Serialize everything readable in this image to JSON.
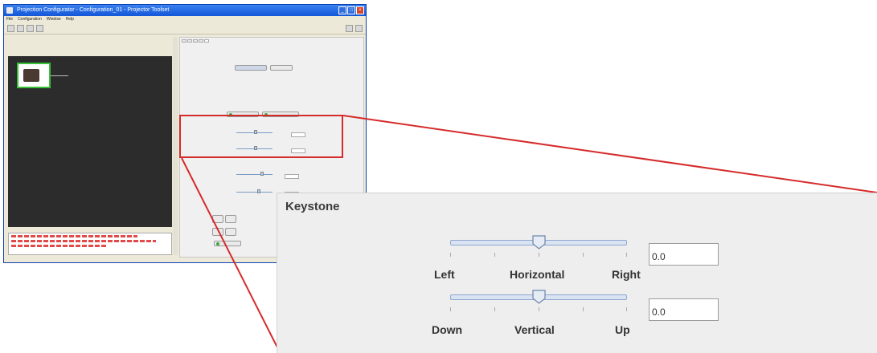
{
  "window": {
    "title": "Projection Configurator - Configuration_01 - Projector Toolset",
    "menu": [
      "File",
      "Configuration",
      "Window",
      "Help"
    ]
  },
  "zoom": {
    "section_title": "Keystone",
    "horizontal": {
      "left_label": "Left",
      "center_label": "Horizontal",
      "right_label": "Right",
      "value": "0.0",
      "level": 0.5
    },
    "vertical": {
      "left_label": "Down",
      "center_label": "Vertical",
      "right_label": "Up",
      "value": "0.0",
      "level": 0.5
    }
  },
  "colors": {
    "highlight": "#d62b2b",
    "titlebar": "#1456d8",
    "slider_track": "#d9e3f2"
  }
}
